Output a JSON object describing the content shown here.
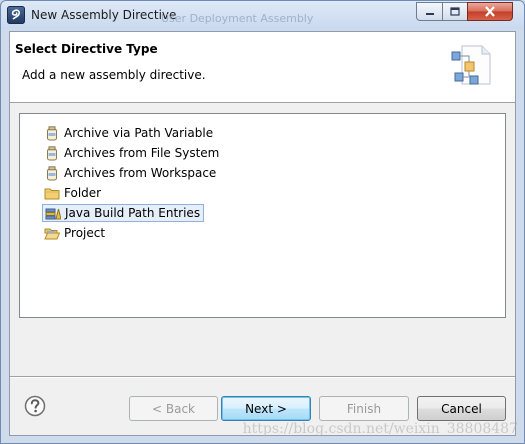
{
  "window": {
    "title": "New Assembly Directive",
    "ghost_title": "User Deployment Assembly"
  },
  "header": {
    "title": "Select Directive Type",
    "description": "Add a new assembly directive."
  },
  "list": {
    "items": [
      {
        "label": "Archive via Path Variable",
        "icon": "jar-icon"
      },
      {
        "label": "Archives from File System",
        "icon": "jar-icon"
      },
      {
        "label": "Archives from Workspace",
        "icon": "jar-icon"
      },
      {
        "label": "Folder",
        "icon": "folder-icon"
      },
      {
        "label": "Java Build Path Entries",
        "icon": "library-icon",
        "selected": true
      },
      {
        "label": "Project",
        "icon": "open-folder-icon"
      }
    ]
  },
  "buttons": {
    "back": "< Back",
    "next": "Next >",
    "finish": "Finish",
    "cancel": "Cancel"
  },
  "watermark": "https://blog.csdn.net/weixin_38808487",
  "colors": {
    "selection": "#e6eef9",
    "default_button": "#bee6fd",
    "close_button": "#c33e2a"
  }
}
